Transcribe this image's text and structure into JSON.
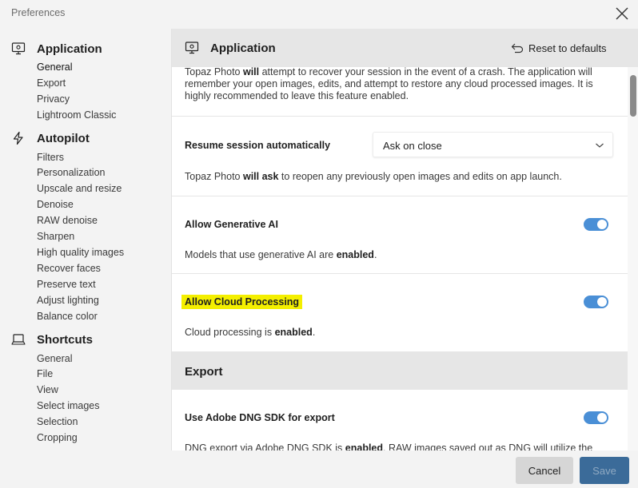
{
  "window": {
    "title": "Preferences"
  },
  "sidebar": {
    "sections": [
      {
        "title": "Application",
        "icon": "monitor-settings-icon",
        "items": [
          "General",
          "Export",
          "Privacy",
          "Lightroom Classic"
        ]
      },
      {
        "title": "Autopilot",
        "icon": "lightning-icon",
        "items": [
          "Filters",
          "Personalization",
          "Upscale and resize",
          "Denoise",
          "RAW denoise",
          "Sharpen",
          "High quality images",
          "Recover faces",
          "Preserve text",
          "Adjust lighting",
          "Balance color"
        ]
      },
      {
        "title": "Shortcuts",
        "icon": "laptop-icon",
        "items": [
          "General",
          "File",
          "View",
          "Select images",
          "Selection",
          "Cropping"
        ]
      }
    ]
  },
  "main": {
    "header": {
      "title": "Application",
      "icon": "monitor-settings-icon",
      "reset_label": "Reset to defaults"
    },
    "intro": {
      "pre": "Topaz Photo ",
      "bold": "will",
      "post": " attempt to recover your session in the event of a crash. The application will remember your open images, edits, and attempt to restore any cloud processed images. It is highly recommended to leave this feature enabled."
    },
    "resume": {
      "label": "Resume session automatically",
      "value": "Ask on close",
      "desc_pre": "Topaz Photo ",
      "desc_bold": "will ask",
      "desc_post": " to reopen any previously open images and edits on app launch."
    },
    "gen_ai": {
      "label": "Allow Generative AI",
      "enabled": true,
      "desc_pre": "Models that use generative AI are ",
      "desc_bold": "enabled",
      "desc_post": "."
    },
    "cloud": {
      "label": "Allow Cloud Processing",
      "enabled": true,
      "desc_pre": "Cloud processing is ",
      "desc_bold": "enabled",
      "desc_post": "."
    },
    "export": {
      "title": "Export",
      "dng": {
        "label": "Use Adobe DNG SDK for export",
        "enabled": true,
        "desc_pre": "DNG export via Adobe DNG SDK is ",
        "desc_bold": "enabled",
        "desc_post": ". RAW images saved out as DNG will utilize the"
      }
    }
  },
  "footer": {
    "cancel_label": "Cancel",
    "save_label": "Save"
  },
  "colors": {
    "toggle_on": "#4a8fd6",
    "highlight": "#f4ef00",
    "save_bg": "#3b6b99"
  }
}
